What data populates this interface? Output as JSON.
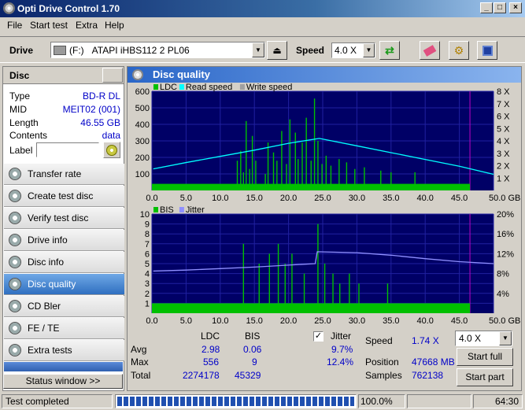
{
  "window": {
    "title": "Opti Drive Control 1.70"
  },
  "menu": [
    "File",
    "Start test",
    "Extra",
    "Help"
  ],
  "toolbar": {
    "drive_label": "Drive",
    "drive_letter": "(F:)",
    "drive_name": "ATAPI  iHBS112   2 PL06",
    "speed_label": "Speed",
    "speed_value": "4.0 X"
  },
  "disc": {
    "header": "Disc",
    "type_label": "Type",
    "type": "BD-R DL",
    "mid_label": "MID",
    "mid": "MEIT02 (001)",
    "length_label": "Length",
    "length": "46.55 GB",
    "contents_label": "Contents",
    "contents": "data",
    "label_label": "Label",
    "label_value": ""
  },
  "nav": [
    "Transfer rate",
    "Create test disc",
    "Verify test disc",
    "Drive info",
    "Disc info",
    "Disc quality",
    "CD Bler",
    "FE / TE",
    "Extra tests"
  ],
  "status_window_btn": "Status window >>",
  "panel": {
    "title": "Disc quality"
  },
  "chart_data": [
    {
      "type": "bar",
      "legend": [
        "LDC",
        "Read speed",
        "Write speed"
      ],
      "x_ticks": [
        "0.0",
        "5.0",
        "10.0",
        "15.0",
        "20.0",
        "25.0",
        "30.0",
        "35.0",
        "40.0",
        "45.0",
        "50.0 GB"
      ],
      "y_ticks": [
        "100",
        "200",
        "300",
        "400",
        "500",
        "600"
      ],
      "y2_ticks": [
        "1 X",
        "2 X",
        "3 X",
        "4 X",
        "5 X",
        "6 X",
        "7 X",
        "8 X"
      ],
      "xlim": [
        0,
        50
      ],
      "ylim": [
        0,
        600
      ],
      "y2lim": [
        0,
        8
      ],
      "ldc_spikes": [
        [
          12.5,
          180
        ],
        [
          13.0,
          240
        ],
        [
          13.4,
          110
        ],
        [
          13.8,
          420
        ],
        [
          14.3,
          130
        ],
        [
          14.7,
          330
        ],
        [
          15.2,
          180
        ],
        [
          16.6,
          100
        ],
        [
          17.0,
          290
        ],
        [
          17.8,
          230
        ],
        [
          18.3,
          180
        ],
        [
          19.0,
          360
        ],
        [
          19.7,
          160
        ],
        [
          20.2,
          430
        ],
        [
          21.0,
          350
        ],
        [
          21.4,
          190
        ],
        [
          22.0,
          290
        ],
        [
          22.6,
          440
        ],
        [
          23.3,
          180
        ],
        [
          23.8,
          556
        ],
        [
          24.3,
          300
        ],
        [
          24.9,
          160
        ],
        [
          25.5,
          210
        ],
        [
          26.2,
          150
        ],
        [
          27.4,
          190
        ],
        [
          28.5,
          170
        ],
        [
          29.7,
          130
        ],
        [
          31.1,
          140
        ],
        [
          33.5,
          120
        ],
        [
          35.0,
          110
        ],
        [
          38.5,
          110
        ]
      ],
      "ldc_base": 40,
      "read_speed": [
        [
          0.2,
          1.74
        ],
        [
          5,
          2.25
        ],
        [
          10,
          2.75
        ],
        [
          15,
          3.25
        ],
        [
          20,
          3.8
        ],
        [
          24.5,
          4.2
        ],
        [
          30,
          3.6
        ],
        [
          35,
          3.05
        ],
        [
          40,
          2.5
        ],
        [
          45,
          1.95
        ],
        [
          50,
          1.3
        ]
      ]
    },
    {
      "type": "bar",
      "legend": [
        "BIS",
        "Jitter"
      ],
      "x_ticks": [
        "0.0",
        "5.0",
        "10.0",
        "15.0",
        "20.0",
        "25.0",
        "30.0",
        "35.0",
        "40.0",
        "45.0",
        "50.0 GB"
      ],
      "y_ticks": [
        "1",
        "2",
        "3",
        "4",
        "5",
        "6",
        "7",
        "8",
        "9",
        "10"
      ],
      "y2_ticks": [
        "4%",
        "8%",
        "12%",
        "16%",
        "20%"
      ],
      "xlim": [
        0,
        50
      ],
      "ylim": [
        0,
        10
      ],
      "y2lim": [
        0,
        20
      ],
      "bis_spikes": [
        [
          13.4,
          7
        ],
        [
          15.7,
          5
        ],
        [
          17.2,
          6
        ],
        [
          18.5,
          7
        ],
        [
          19.5,
          5
        ],
        [
          20.5,
          6
        ],
        [
          22.3,
          4
        ],
        [
          24.3,
          9
        ],
        [
          25.3,
          5
        ],
        [
          26.5,
          4
        ],
        [
          27.5,
          3
        ],
        [
          28.9,
          4
        ],
        [
          30.3,
          3
        ],
        [
          34.5,
          3
        ]
      ],
      "bis_base": 1,
      "jitter": [
        [
          0.2,
          8.5
        ],
        [
          5,
          8.7
        ],
        [
          10,
          9.0
        ],
        [
          15,
          9.3
        ],
        [
          20,
          9.7
        ],
        [
          23.9,
          10.0
        ],
        [
          24.2,
          12.4
        ],
        [
          30,
          12.2
        ],
        [
          35,
          11.7
        ],
        [
          40,
          11.0
        ],
        [
          45,
          10.4
        ],
        [
          50,
          10.0
        ]
      ]
    }
  ],
  "stats": {
    "col_ldc": "LDC",
    "col_bis": "BIS",
    "jitter_label": "Jitter",
    "avg_label": "Avg",
    "max_label": "Max",
    "total_label": "Total",
    "avg_ldc": "2.98",
    "avg_bis": "0.06",
    "avg_jit": "9.7%",
    "max_ldc": "556",
    "max_bis": "9",
    "max_jit": "12.4%",
    "total_ldc": "2274178",
    "total_bis": "45329",
    "speed_label": "Speed",
    "speed_val": "1.74 X",
    "speed_select": "4.0 X",
    "position_label": "Position",
    "position_val": "47668 MB",
    "samples_label": "Samples",
    "samples_val": "762138",
    "start_full": "Start full",
    "start_part": "Start part"
  },
  "status": {
    "text": "Test completed",
    "progress": "100.0%",
    "progress_value": 1.0,
    "time": "64:30"
  },
  "colors": {
    "ldc": "#00c000",
    "read": "#00ffff",
    "write": "#a0a0a0",
    "bis": "#00c000",
    "jitter": "#9090ff"
  }
}
